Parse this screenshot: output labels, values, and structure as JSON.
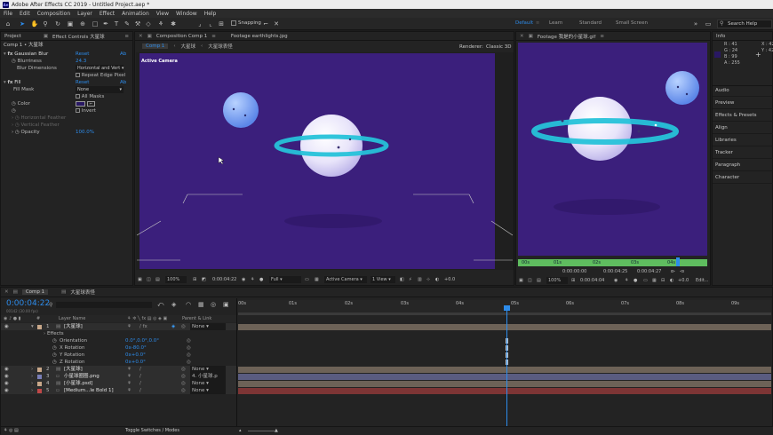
{
  "title": "Adobe After Effects CC 2019 - Untitled Project.aep *",
  "menu": [
    "File",
    "Edit",
    "Composition",
    "Layer",
    "Effect",
    "Animation",
    "View",
    "Window",
    "Help"
  ],
  "toolbar": {
    "snapping": "Snapping"
  },
  "workspaces": [
    "Default",
    "Learn",
    "Standard",
    "Small Screen"
  ],
  "search_help": "Search Help",
  "project_panel": {
    "project_tab": "Project",
    "effect_controls_tab": "Effect Controls 大星球",
    "comp_title": "Comp 1 • 大星球"
  },
  "effects": {
    "gaussian_blur": "Gaussian Blur",
    "reset": "Reset",
    "about": "Ab",
    "blurriness_label": "Blurriness",
    "blurriness_value": "24.3",
    "blur_dimensions_label": "Blur Dimensions",
    "blur_dimensions_value": "Horizontal and Vert",
    "repeat_edge": "Repeat Edge Pixel",
    "fill": "Fill",
    "fill_mask_label": "Fill Mask",
    "fill_mask_value": "None",
    "all_masks": "All Masks",
    "color_label": "Color",
    "invert": "Invert",
    "h_feather": "Horizontal Feather",
    "v_feather": "Vertical Feather",
    "opacity_label": "Opacity",
    "opacity_value": "100.0%"
  },
  "comp_viewer": {
    "tab": "Composition Comp 1",
    "footage_tab": "Footage earthlights.jpg",
    "sub_tab": "Comp 1",
    "breadcrumb_a": "大星球",
    "breadcrumb_b": "大星球表怪",
    "renderer_label": "Renderer:",
    "renderer_value": "Classic 3D",
    "camera_label": "Active Camera",
    "zoom": "100%",
    "timecode": "0:00:04:22",
    "resolution": "Full",
    "camera_select": "Active Camera",
    "view_select": "1 View",
    "exposure": "+0.0"
  },
  "footage_viewer": {
    "tab": "Footage 我是的小星球.gif",
    "ruler_labels": [
      "00s",
      "01s",
      "02s",
      "03s",
      "04s"
    ],
    "tc_in": "0:00:00:00",
    "tc_out": "0:00:04:25",
    "tc_dur": "0:00:04:27",
    "zoom": "100%",
    "timecode": "0:00:04:04",
    "exposure": "+0.0",
    "edit": "Edit..."
  },
  "info_panel": {
    "title": "Info",
    "r": "R : 41",
    "g": "G : 24",
    "b": "B : 99",
    "a": "A : 255",
    "x": "X : 42",
    "y": "Y : 42",
    "swatch": "#291863"
  },
  "right_panels": [
    "Audio",
    "Preview",
    "Effects & Presets",
    "Align",
    "Libraries",
    "Tracker",
    "Paragraph",
    "Character"
  ],
  "timeline": {
    "tabs": [
      "Comp 1",
      "大星球表怪"
    ],
    "current_time": "0:00:04:22",
    "frames_sub": "00142 (30.00 fps)",
    "ruler": [
      "00s",
      "01s",
      "02s",
      "03s",
      "04s",
      "05s",
      "06s",
      "07s",
      "08s",
      "09s"
    ],
    "col_layer_name": "Layer Name",
    "col_parent": "Parent & Link",
    "layers": [
      {
        "num": "1",
        "name": "[大星球]",
        "parent": "None",
        "color": "#c9a88a"
      },
      {
        "num": "2",
        "name": "[大星球]",
        "parent": "None",
        "color": "#c9a88a"
      },
      {
        "num": "3",
        "name": "小星球圈圈.png",
        "parent": "4. 小星球.p",
        "color": "#7a7fb8"
      },
      {
        "num": "4",
        "name": "[小星球.psd]",
        "parent": "None",
        "color": "#c9a88a"
      },
      {
        "num": "5",
        "name": "[Medium...le Bold 1]",
        "parent": "None",
        "color": "#c04848"
      }
    ],
    "effects_label": "Effects",
    "transform_props": [
      {
        "label": "Orientation",
        "value": "0.0°,0.0°,0.0°"
      },
      {
        "label": "X Rotation",
        "value": "0x-80.0°"
      },
      {
        "label": "Y Rotation",
        "value": "0x+0.0°"
      },
      {
        "label": "Z Rotation",
        "value": "0x+0.0°"
      }
    ],
    "footer": "Toggle Switches / Modes"
  }
}
